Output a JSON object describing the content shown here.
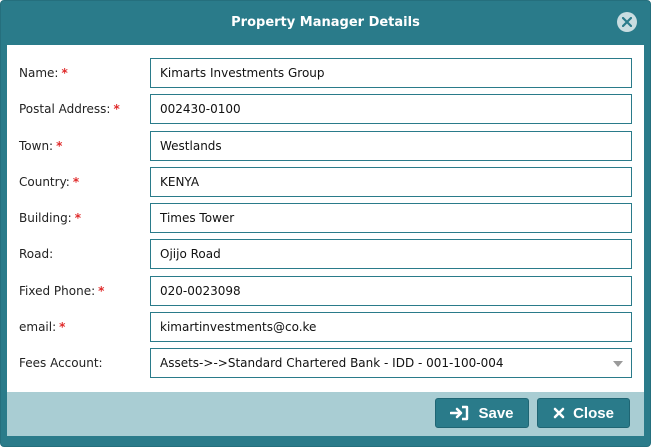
{
  "dialog": {
    "title": "Property Manager Details"
  },
  "form": {
    "fields": [
      {
        "label": "Name:",
        "required": "*",
        "value": "Kimarts  Investments Group"
      },
      {
        "label": "Postal Address:",
        "required": "*",
        "value": "002430-0100"
      },
      {
        "label": "Town:",
        "required": "*",
        "value": "Westlands"
      },
      {
        "label": "Country:",
        "required": "*",
        "value": "KENYA"
      },
      {
        "label": "Building:",
        "required": "*",
        "value": "Times Tower"
      },
      {
        "label": "Road:",
        "required": "",
        "value": "Ojijo Road"
      },
      {
        "label": "Fixed Phone:",
        "required": "*",
        "value": "020-0023098"
      },
      {
        "label": "email:",
        "required": "*",
        "value": "kimartinvestments@co.ke"
      }
    ],
    "fees_account": {
      "label": "Fees Account:",
      "selected": "Assets->->Standard Chartered Bank - IDD - 001-100-004"
    }
  },
  "footer": {
    "save_label": "Save",
    "close_label": "Close"
  },
  "icons": {
    "close": "close-circle-icon",
    "save": "sign-in-icon",
    "close_button": "x-icon"
  },
  "colors": {
    "header": "#2a7b8a",
    "footer": "#a9cdd3",
    "required": "#e02b2b"
  }
}
